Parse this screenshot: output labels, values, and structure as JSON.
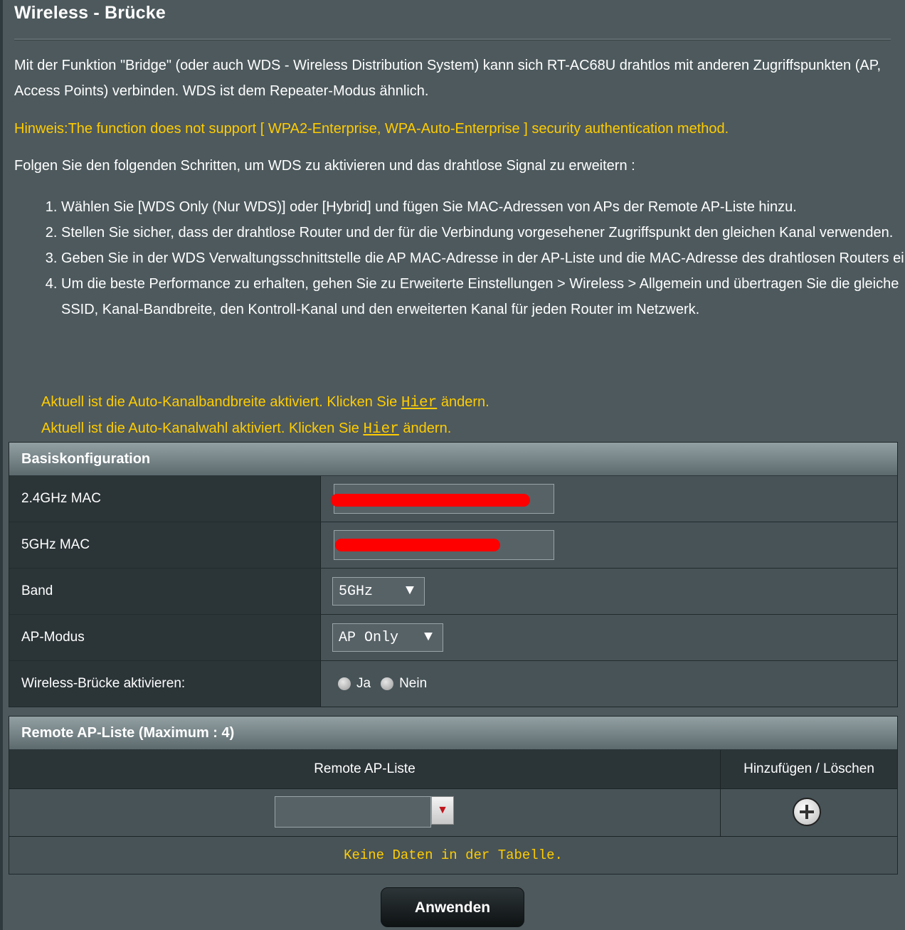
{
  "page": {
    "title": "Wireless - Brücke",
    "description": "Mit der Funktion \"Bridge\" (oder auch WDS - Wireless Distribution System) kann sich RT-AC68U drahtlos mit anderen Zugriffspunkten (AP, Access Points) verbinden. WDS ist dem Repeater-Modus ähnlich.",
    "hint": "Hinweis:The function does not support [ WPA2-Enterprise, WPA-Auto-Enterprise ] security authentication method.",
    "steps_intro": "Folgen Sie den folgenden Schritten, um WDS zu aktivieren und das drahtlose Signal zu erweitern :",
    "steps": [
      "Wählen Sie [WDS Only (Nur WDS)] oder [Hybrid] und fügen Sie MAC-Adressen von APs der Remote AP-Liste hinzu.",
      "Stellen Sie sicher, dass der drahtlose Router und der für die Verbindung vorgesehener Zugriffspunkt den gleichen Kanal verwenden.",
      "Geben Sie in der WDS Verwaltungsschnittstelle die AP MAC-Adresse in der AP-Liste und die MAC-Adresse des drahtlosen Routers ein.",
      "Um die beste Performance zu erhalten, gehen Sie zu Erweiterte Einstellungen > Wireless > Allgemein und übertragen Sie die gleiche SSID, Kanal-Bandbreite, den Kontroll-Kanal und den erweiterten Kanal für jeden Router im Netzwerk."
    ],
    "notice_bandwidth_prefix": "Aktuell ist die Auto-Kanalbandbreite aktiviert. Klicken Sie ",
    "notice_bandwidth_link": "Hier",
    "notice_bandwidth_suffix": " ändern.",
    "notice_channel_prefix": "Aktuell ist die Auto-Kanalwahl aktiviert. Klicken Sie ",
    "notice_channel_link": "Hier",
    "notice_channel_suffix": " ändern."
  },
  "basic": {
    "header": "Basiskonfiguration",
    "mac24_label": "2.4GHz MAC",
    "mac24_value": "",
    "mac5_label": "5GHz MAC",
    "mac5_value": "",
    "band_label": "Band",
    "band_value": "5GHz",
    "ap_mode_label": "AP-Modus",
    "ap_mode_value": "AP Only",
    "bridge_label": "Wireless-Brücke aktivieren:",
    "bridge_yes": "Ja",
    "bridge_no": "Nein",
    "bridge_selected": "none"
  },
  "remote": {
    "header": "Remote AP-Liste (Maximum : 4)",
    "col_list": "Remote AP-Liste",
    "col_action": "Hinzufügen / Löschen",
    "empty_text": "Keine Daten in der Tabelle.",
    "dropdown_arrow": "▼"
  },
  "actions": {
    "apply_label": "Anwenden"
  },
  "icons": {
    "select_arrow": "▼",
    "add": "plus-circle-icon"
  },
  "colors": {
    "background": "#4d595d",
    "highlight": "#ffcc00",
    "redaction": "#ff0000"
  }
}
